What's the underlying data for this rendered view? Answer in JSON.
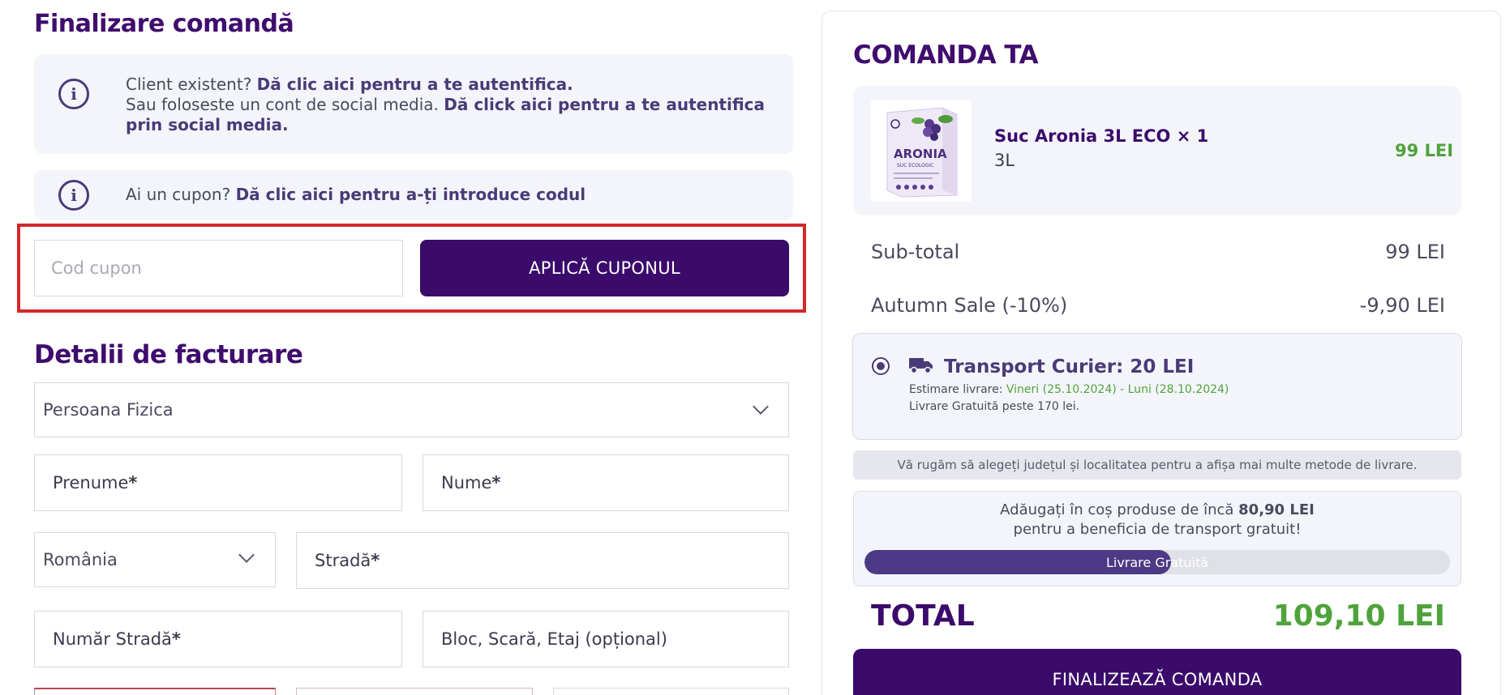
{
  "left": {
    "page_title": "Finalizare comandă",
    "login_notice": {
      "line1_prefix": "Client existent? ",
      "line1_link": "Dă clic aici pentru a te autentifica.",
      "line2_prefix": "Sau foloseste un cont de social media. ",
      "line2_link": "Dă click aici pentru a te autentifica prin social media."
    },
    "coupon_notice": {
      "prefix": "Ai un cupon? ",
      "link": "Dă clic aici pentru a-ți introduce codul"
    },
    "coupon_input_placeholder": "Cod cupon",
    "apply_coupon_label": "APLICĂ CUPONUL",
    "billing_title": "Detalii de facturare",
    "person_type": "Persoana Fizica",
    "fields": {
      "first_name": "Prenume",
      "last_name": "Nume",
      "country": "România",
      "street": "Stradă",
      "street_number": "Număr Stradă",
      "building": "Bloc, Scară, Etaj (opțional)",
      "required_mark": " *"
    }
  },
  "right": {
    "summary_title": "COMANDA TA",
    "product": {
      "name": "Suc Aronia 3L ECO × 1",
      "variant": "3L",
      "price": "99 LEI",
      "thumb_brand": "ARONIA",
      "thumb_sub": "SUC ECOLOGIC"
    },
    "subtotal_label": "Sub-total",
    "subtotal_value": "99 LEI",
    "discount_label": "Autumn Sale (-10%)",
    "discount_value": "-9,90 LEI",
    "shipping": {
      "title": "Transport Curier: 20 LEI",
      "estimate_prefix": "Estimare livrare: ",
      "estimate_dates": "Vineri (25.10.2024) - Luni (28.10.2024)",
      "free_note": "Livrare Gratuită peste 170 lei."
    },
    "notice": "Vă rugăm să alegeți județul și localitatea pentru a afișa mai multe metode de livrare.",
    "free_shipping": {
      "line1_prefix": "Adăugați în coș produse de încă ",
      "line1_amount": "80,90 LEI",
      "line2": "pentru a beneficia de transport gratuit!",
      "progress_label": "Livrare Gratuită",
      "progress_fraction": 0.524
    },
    "total_label": "TOTAL",
    "total_value": "109,10 LEI",
    "checkout_label": "FINALIZEAZĂ COMANDA"
  },
  "colors": {
    "brand_purple": "#3b0b6b",
    "accent_green": "#4fa33b",
    "highlight_red": "#d3282c"
  }
}
